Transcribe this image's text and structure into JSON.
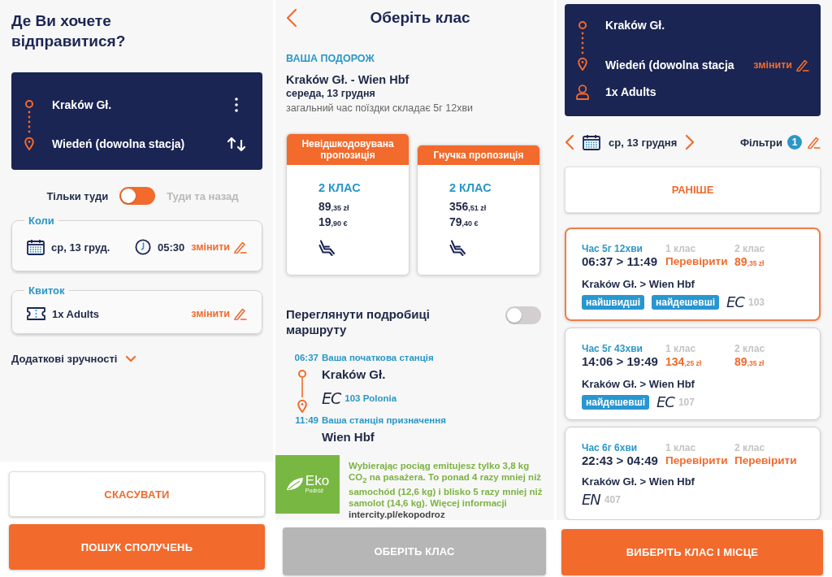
{
  "search_screen": {
    "title": "Де Ви хочете відправитися?",
    "route": {
      "from": "Kraków Gł.",
      "to": "Wiedeń (dowolna stacja)"
    },
    "trip_type": {
      "one_way": "Тільки туди",
      "round_trip": "Туди та назад",
      "round_trip_selected": false
    },
    "when": {
      "legend": "Коли",
      "date": "ср, 13 груд.",
      "time": "05:30",
      "edit": "змінити"
    },
    "ticket": {
      "legend": "Квиток",
      "passengers": "1x Adults",
      "edit": "змінити"
    },
    "extras": {
      "label": "Додаткові зручності",
      "expanded": false
    },
    "buttons": [
      {
        "label": "СКАСУВАТИ",
        "kind": "secondary"
      },
      {
        "label": "ПОШУК СПОЛУЧЕНЬ",
        "kind": "primary"
      }
    ]
  },
  "class_screen": {
    "title": "Оберіть клас",
    "journey_heading": "ВАША ПОДОРОЖ",
    "route": "Kraków Gł. - Wien Hbf",
    "date": "середа, 13 грудня",
    "duration": "загальний час поїздки складає 5г 12хви",
    "offers": [
      {
        "title": "Невідшкодовувана пропозиція",
        "class": "2 КЛАС",
        "prices": [
          {
            "main": "89",
            "minor": ",35 zł"
          },
          {
            "main": "19",
            "minor": ",90 €"
          }
        ],
        "selected": false
      },
      {
        "title": "Гнучка пропозиція",
        "class": "2 КЛАС",
        "prices": [
          {
            "main": "356",
            "minor": ",51 zł"
          },
          {
            "main": "79",
            "minor": ",40 €"
          }
        ],
        "selected": false
      }
    ],
    "route_details": {
      "label": "Переглянути подробиці маршруту",
      "on": false
    },
    "itinerary": {
      "departure": {
        "time": "06:37",
        "caption": "Ваша початкова станція",
        "station": "Kraków Gł."
      },
      "train": {
        "carrier": "EC",
        "name": "103 Polonia"
      },
      "arrival": {
        "time": "11:49",
        "caption": "Ваша станція призначення",
        "station": "Wien Hbf"
      }
    },
    "eco": {
      "logo": "Eko",
      "logo_subtitle": "Podróż",
      "text": "Wybierając pociąg emitujesz tylko 3,8 kg CO$_{2}$ na pasażera. To ponad 4 razy mniej niż samochód (12,6 kg) i blisko 5 razy mniej niż samolot (14,6 kg). Więcej informacji",
      "link": "intercity.pl/ekopodroz"
    },
    "button": {
      "label": "ОБЕРІТЬ КЛАС",
      "disabled": true
    }
  },
  "results_screen": {
    "route": {
      "from": "Kraków Gł.",
      "to": "Wiedeń (dowolna stacja",
      "passengers": "1x Adults",
      "edit": "змінити"
    },
    "date": "ср, 13 грудня",
    "filters": {
      "label": "Фільтри",
      "count": "1"
    },
    "earlier_button": "РАНІШЕ",
    "connections": [
      {
        "duration": "Час 5г 12хви",
        "times": "06:37 > 11:49",
        "fares": [
          {
            "label": "1 клас",
            "kind": "check",
            "text": "Перевірити"
          },
          {
            "label": "2 клас",
            "kind": "price",
            "main": "89",
            "minor": ",35 zł"
          }
        ],
        "route": "Kraków Gł. > Wien Hbf",
        "tags": [
          "найшвидші",
          "найдешевші"
        ],
        "carrier": "EC",
        "number": "103",
        "selected": true
      },
      {
        "duration": "Час 5г 43хви",
        "times": "14:06 > 19:49",
        "fares": [
          {
            "label": "1 клас",
            "kind": "price",
            "main": "134",
            "minor": ",25 zł"
          },
          {
            "label": "2 клас",
            "kind": "price",
            "main": "89",
            "minor": ",35 zł"
          }
        ],
        "route": "Kraków Gł. > Wien Hbf",
        "tags": [
          "найдешевші"
        ],
        "carrier": "EC",
        "number": "107",
        "selected": false
      },
      {
        "duration": "Час 6г 6хви",
        "times": "22:43 > 04:49",
        "fares": [
          {
            "label": "1 клас",
            "kind": "check",
            "text": "Перевірити"
          },
          {
            "label": "2 клас",
            "kind": "check",
            "text": "Перевірити"
          }
        ],
        "route": "Kraków Gł. > Wien Hbf",
        "carrier": "EN",
        "number": "407",
        "selected": false
      }
    ],
    "button": "ВИБЕРІТЬ КЛАС І МІСЦЕ"
  }
}
